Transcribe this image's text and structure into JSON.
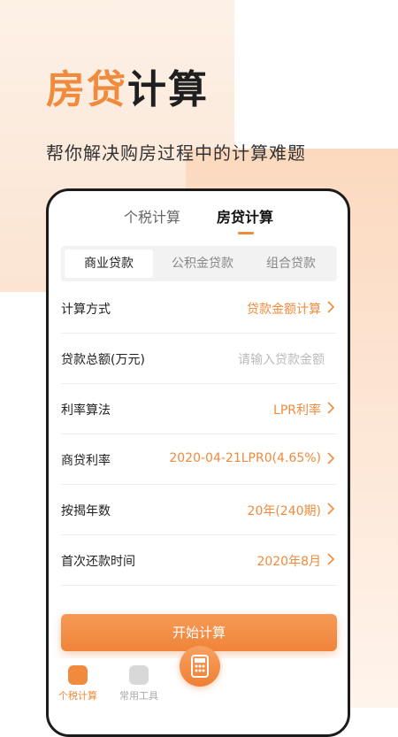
{
  "hero": {
    "title_accent": "房贷",
    "title_dark": "计算",
    "subtitle": "帮你解决购房过程中的计算难题"
  },
  "top_tabs": {
    "tax": "个税计算",
    "mortgage": "房贷计算",
    "active": "mortgage"
  },
  "segments": {
    "items": [
      "商业贷款",
      "公积金贷款",
      "组合贷款"
    ],
    "active_index": 0
  },
  "form": {
    "rows": [
      {
        "label": "计算方式",
        "value": "贷款金额计算",
        "type": "select"
      },
      {
        "label": "贷款总额(万元)",
        "placeholder": "请输入贷款金额",
        "type": "input"
      },
      {
        "label": "利率算法",
        "value": "LPR利率",
        "type": "select"
      },
      {
        "label": "商贷利率",
        "value": "2020-04-21LPR0(4.65%)",
        "type": "select"
      },
      {
        "label": "按揭年数",
        "value": "20年(240期)",
        "type": "select"
      },
      {
        "label": "首次还款时间",
        "value": "2020年8月",
        "type": "select"
      }
    ]
  },
  "start_button": "开始计算",
  "bottom_nav": {
    "items": [
      {
        "label": "个税计算",
        "active": true
      },
      {
        "label": "常用工具",
        "active": false
      }
    ]
  },
  "colors": {
    "accent": "#f08a3c",
    "text_dark": "#1f1f1f",
    "placeholder": "#bbbbbb"
  }
}
